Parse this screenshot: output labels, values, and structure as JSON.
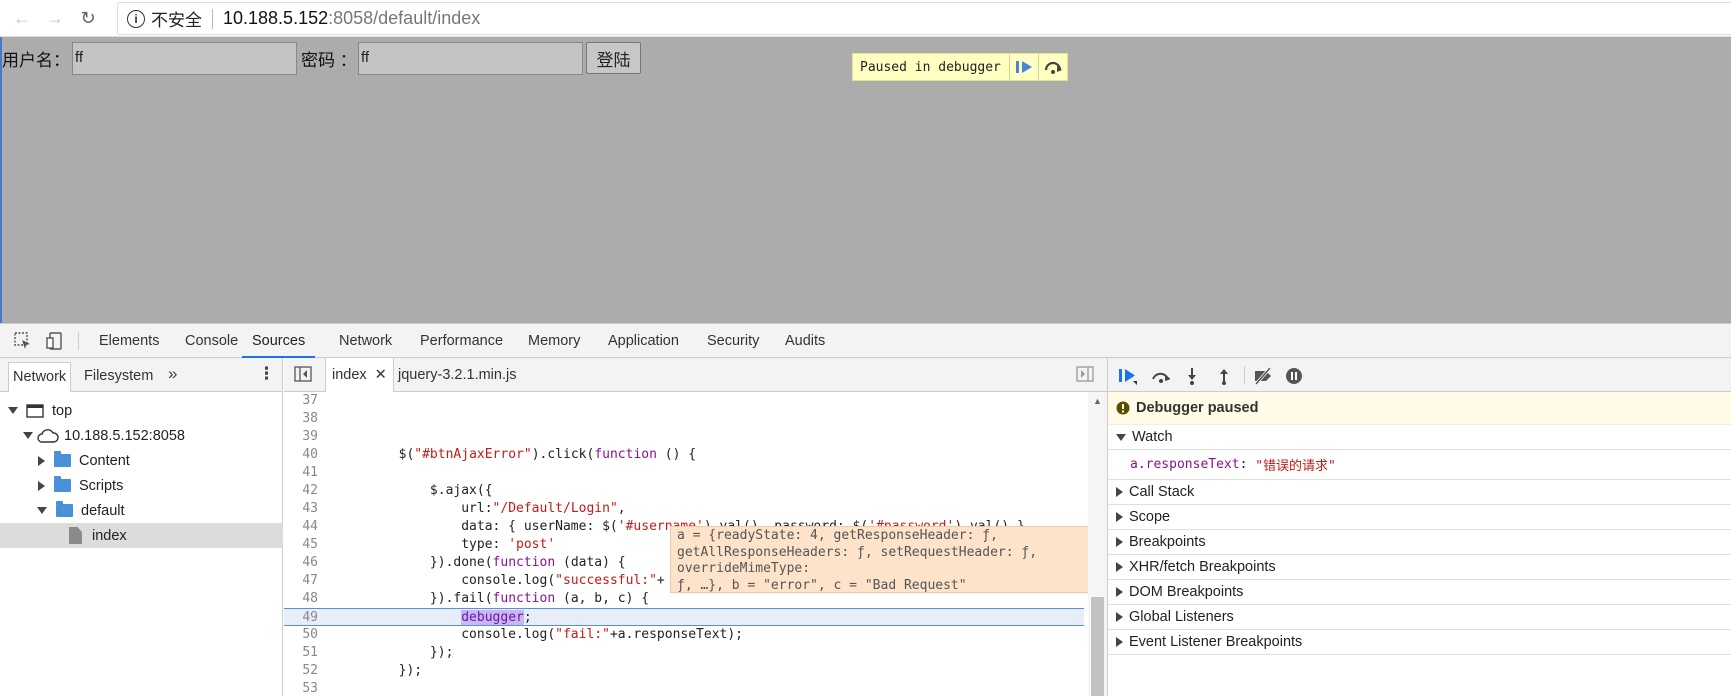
{
  "browser": {
    "insecure_label": "不安全",
    "url_host": "10.188.5.152",
    "url_path": ":8058/default/index"
  },
  "page": {
    "username_label": "用户名：",
    "username_value": "ff",
    "password_label": "密码 ：",
    "password_value": "ff",
    "login_label": "登陆",
    "paused_text": "Paused in debugger"
  },
  "devtools": {
    "tabs": [
      "Elements",
      "Console",
      "Sources",
      "Network",
      "Performance",
      "Memory",
      "Application",
      "Security",
      "Audits"
    ],
    "active_tab": "Sources",
    "navigator": {
      "tabs": [
        "Network",
        "Filesystem"
      ],
      "tree": [
        {
          "label": "top"
        },
        {
          "label": "10.188.5.152:8058"
        },
        {
          "label": "Content"
        },
        {
          "label": "Scripts"
        },
        {
          "label": "default"
        },
        {
          "label": "index"
        }
      ]
    },
    "editor": {
      "tabs": [
        "index",
        "jquery-3.2.1.min.js"
      ],
      "active_tab": "index",
      "tooltip_lines": [
        "a = {readyState: 4, getResponseHeader: ƒ,",
        "getAllResponseHeaders: ƒ, setRequestHeader: ƒ,",
        "overrideMimeType:",
        "ƒ, …}, b = \"error\", c = \"Bad Request\""
      ]
    },
    "debugger": {
      "paused_label": "Debugger paused",
      "watch_label": "Watch",
      "watch_expr": "a.responseText",
      "watch_value": "\"错误的请求\"",
      "sections": [
        "Call Stack",
        "Scope",
        "Breakpoints",
        "XHR/fetch Breakpoints",
        "DOM Breakpoints",
        "Global Listeners",
        "Event Listener Breakpoints"
      ]
    },
    "colors": {
      "accent": "#1a73e8",
      "string": "#c41a16",
      "keyword": "#881391"
    }
  }
}
